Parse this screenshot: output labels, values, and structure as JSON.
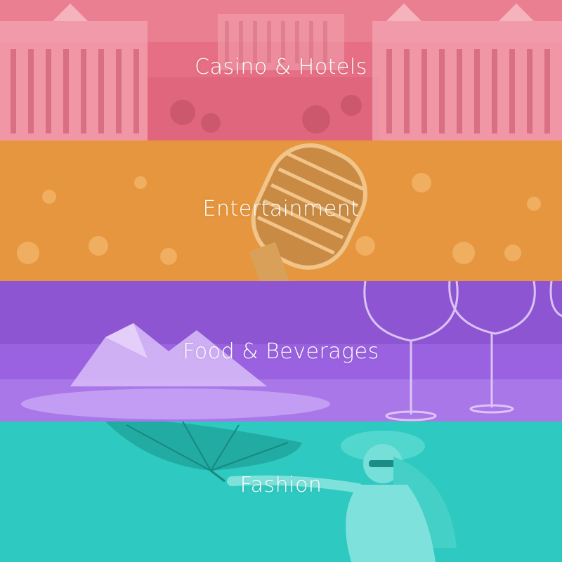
{
  "categories": [
    {
      "id": "casino",
      "label": "Casino & Hotels",
      "color": "#e66f85"
    },
    {
      "id": "entertainment",
      "label": "Entertainment",
      "color": "#e6963e"
    },
    {
      "id": "food",
      "label": "Food & Beverages",
      "color": "#9a62e0"
    },
    {
      "id": "fashion",
      "label": "Fashion",
      "color": "#2ec9c0"
    }
  ]
}
